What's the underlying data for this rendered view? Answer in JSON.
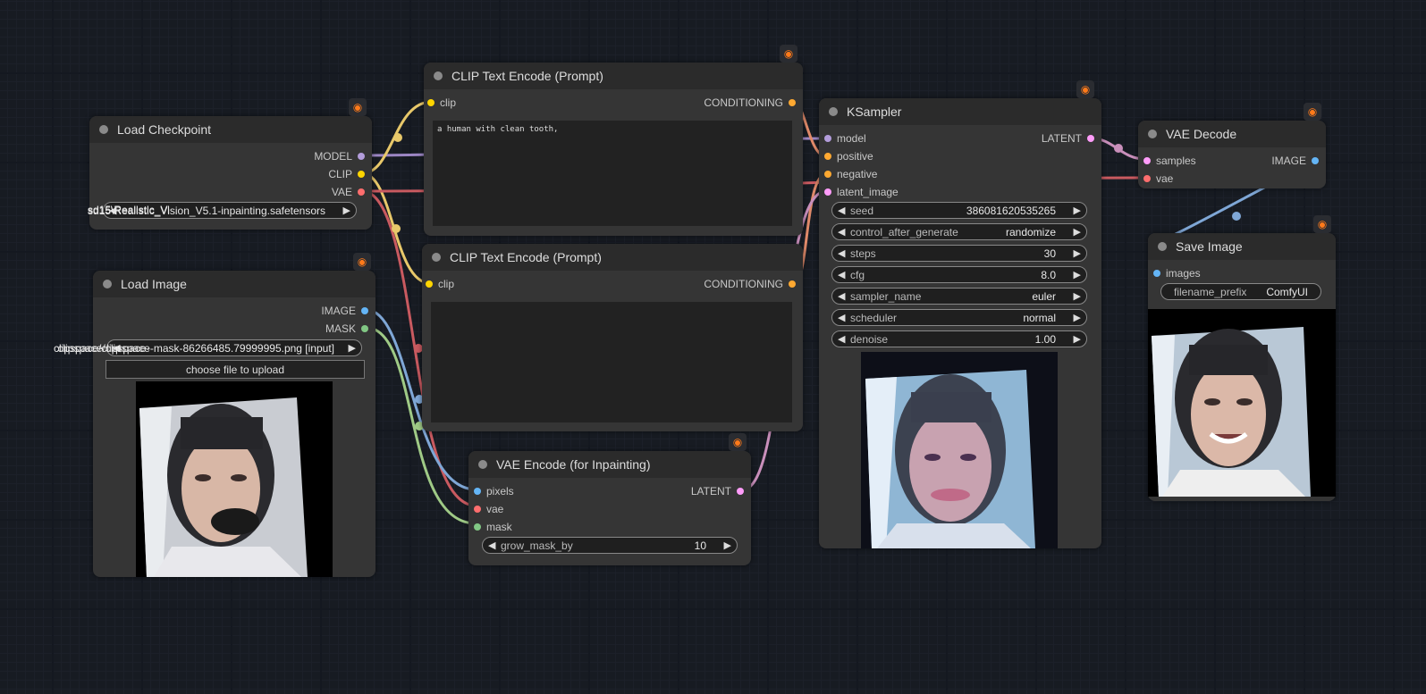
{
  "colors": {
    "background": "#171b22",
    "node_body": "#353535",
    "node_header": "#2b2b2b",
    "model": "#b39ddb",
    "clip": "#ffd500",
    "vae": "#ff6e6e",
    "conditioning": "#ffa931",
    "latent": "#ff9cf9",
    "image": "#64b5f6",
    "mask": "#81c784"
  },
  "nodes": {
    "load_checkpoint": {
      "title": "Load Checkpoint",
      "outputs": [
        "MODEL",
        "CLIP",
        "VAE"
      ],
      "ckpt_name": "sd15\\Realistic_Vision_V5.1-inpainting.safetensors",
      "ckpt_overflow": "sd15\\Realistic_Vi"
    },
    "load_image": {
      "title": "Load Image",
      "outputs": [
        "IMAGE",
        "MASK"
      ],
      "image": "clipspace/clipspace-mask-86266485.79999995.png [input]",
      "image_overflow": "clipspace/clipspace-",
      "upload_label": "choose file to upload"
    },
    "clip_text_positive": {
      "title": "CLIP Text Encode (Prompt)",
      "input": "clip",
      "output": "CONDITIONING",
      "text": "a human with clean tooth,"
    },
    "clip_text_negative": {
      "title": "CLIP Text Encode (Prompt)",
      "input": "clip",
      "output": "CONDITIONING",
      "text": ""
    },
    "vae_encode": {
      "title": "VAE Encode (for Inpainting)",
      "inputs": [
        "pixels",
        "vae",
        "mask"
      ],
      "output": "LATENT",
      "grow_mask_by": {
        "label": "grow_mask_by",
        "value": "10"
      }
    },
    "ksampler": {
      "title": "KSampler",
      "inputs": [
        "model",
        "positive",
        "negative",
        "latent_image"
      ],
      "output": "LATENT",
      "widgets": [
        {
          "label": "seed",
          "value": "386081620535265"
        },
        {
          "label": "control_after_generate",
          "value": "randomize"
        },
        {
          "label": "steps",
          "value": "30"
        },
        {
          "label": "cfg",
          "value": "8.0"
        },
        {
          "label": "sampler_name",
          "value": "euler"
        },
        {
          "label": "scheduler",
          "value": "normal"
        },
        {
          "label": "denoise",
          "value": "1.00"
        }
      ]
    },
    "vae_decode": {
      "title": "VAE Decode",
      "inputs": [
        "samples",
        "vae"
      ],
      "output": "IMAGE"
    },
    "save_image": {
      "title": "Save Image",
      "input": "images",
      "filename_prefix": {
        "label": "filename_prefix",
        "value": "ComfyUI"
      }
    }
  },
  "icons": {
    "badge": "fox-badge-icon",
    "arrow_left": "arrow-left-icon",
    "arrow_right": "arrow-right-icon"
  }
}
